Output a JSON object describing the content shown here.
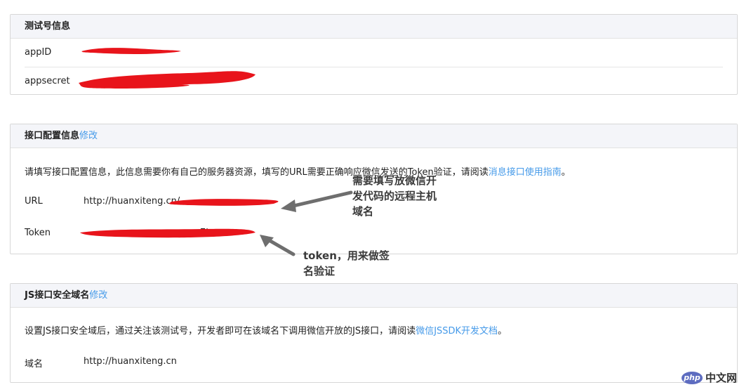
{
  "test_account": {
    "title": "测试号信息",
    "fields": [
      {
        "label": "appID",
        "value": ""
      },
      {
        "label": "appsecret",
        "value": ""
      }
    ]
  },
  "interface_config": {
    "title": "接口配置信息",
    "edit_label": "修改",
    "description": "请填写接口配置信息，此信息需要你有自己的服务器资源，填写的URL需要正确响应微信发送的Token验证，请阅读",
    "description_link": "消息接口使用指南",
    "description_end": "。",
    "url_label": "URL",
    "url_value": "http://huanxiteng.cn/",
    "token_label": "Token",
    "token_value_tail": "7b"
  },
  "js_domain": {
    "title": "JS接口安全域名",
    "edit_label": "修改",
    "description": "设置JS接口安全域后，通过关注该测试号，开发者即可在该域名下调用微信开放的JS接口，请阅读",
    "description_link": "微信JSSDK开发文档",
    "description_end": "。",
    "domain_label": "域名",
    "domain_value": "http://huanxiteng.cn"
  },
  "annotations": {
    "url_note_line1": "需要填写放微信开",
    "url_note_line2": "发代码的远程主机",
    "url_note_line3": "域名",
    "token_note_line1": "token，用来做签",
    "token_note_line2": "名验证"
  },
  "watermark": {
    "badge": "php",
    "text": "中文网"
  },
  "colors": {
    "link": "#459ae9",
    "header_bg": "#f4f5f9",
    "redaction": "#e8141b"
  }
}
